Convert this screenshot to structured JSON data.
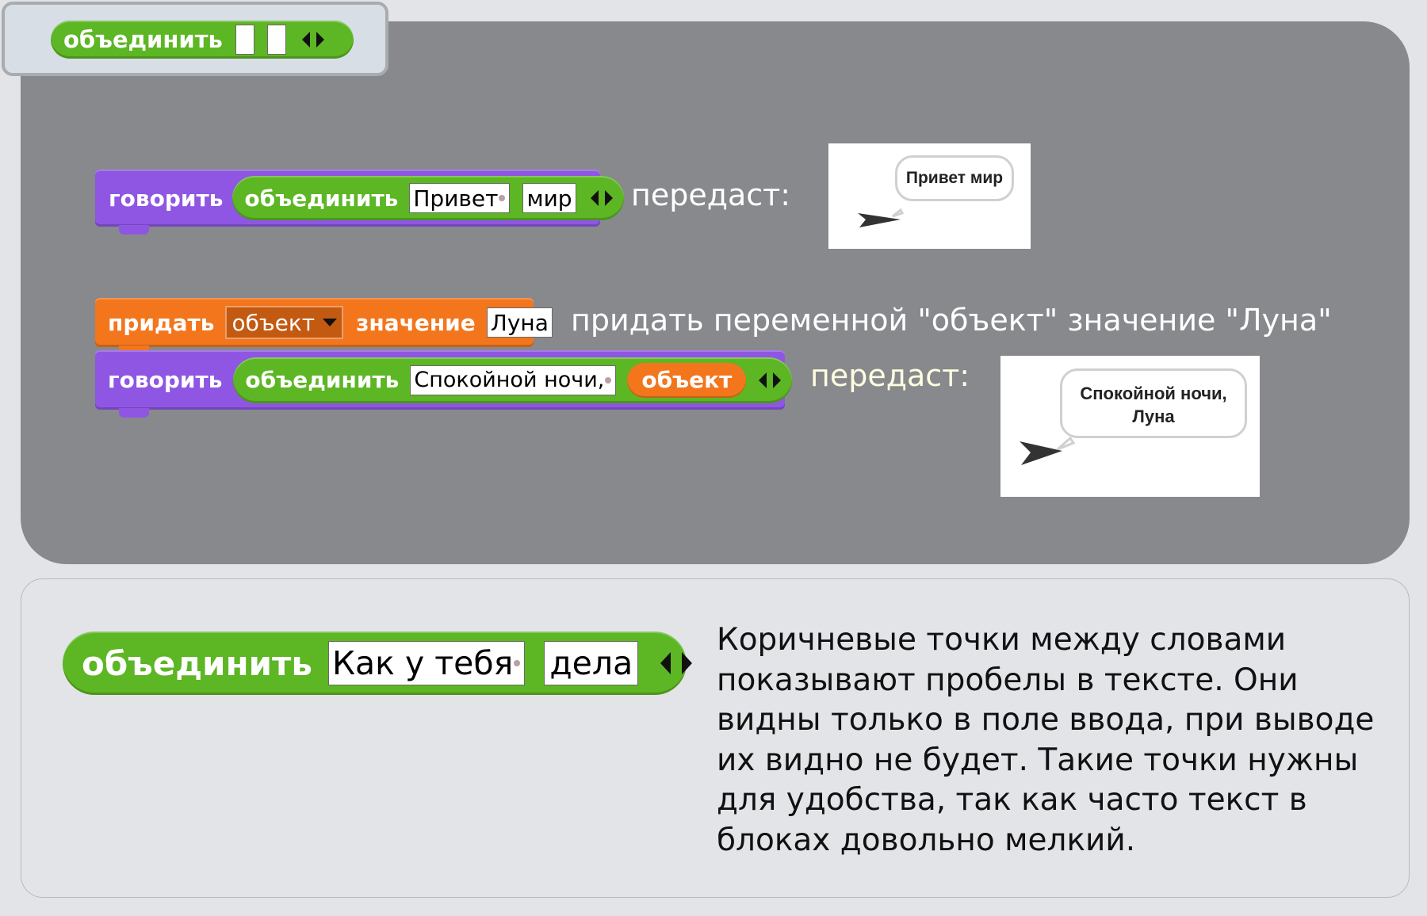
{
  "palette": {
    "tab_block": {
      "label": "объединить"
    },
    "stage_bg": "#87898c",
    "green": "#5db624",
    "purple": "#8f56e3",
    "orange": "#f3761d"
  },
  "example1": {
    "say_label": "говорить",
    "join_label": "объединить",
    "slot1": "Привет",
    "slot2": "мир",
    "result_label": "передаст:",
    "bubble_text": "Привет мир"
  },
  "example2": {
    "set_label": "придать",
    "var_name": "объект",
    "value_label": "значение",
    "value": "Луна",
    "caption": "придать переменной \"объект\" значение \"Луна\"",
    "say_label": "говорить",
    "join_label": "объединить",
    "slot1": "Спокойной ночи,",
    "var_reporter": "объект",
    "result_label": "передаст:",
    "bubble_line1": "Спокойной ночи,",
    "bubble_line2": "Луна"
  },
  "info": {
    "join_label": "объединить",
    "slot1": "Как у тебя",
    "slot2": "дела",
    "description": "Коричневые точки между словами показывают пробелы в тексте. Они видны только в поле ввода, при выводе их видно не будет. Такие точки нужны для удобства, так как часто текст в блоках довольно мелкий."
  }
}
